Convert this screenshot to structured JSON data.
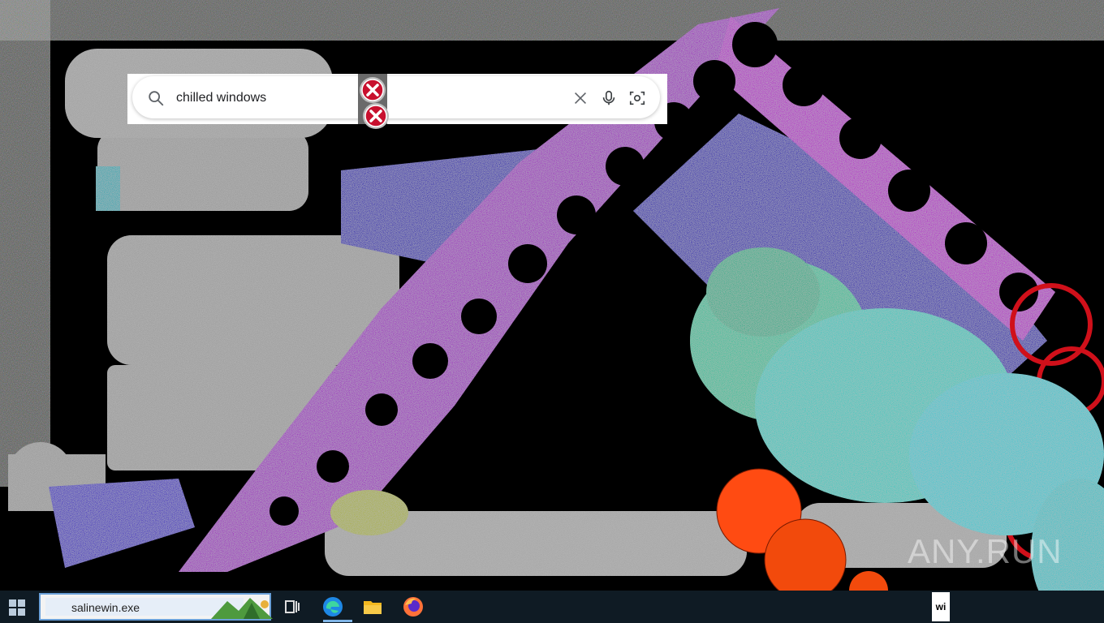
{
  "search": {
    "query": "chilled windows"
  },
  "icons": {
    "search": "search-icon",
    "clear": "close-icon",
    "voice": "microphone-icon",
    "lens": "camera-lens-icon",
    "error": "error-x-icon"
  },
  "taskbar": {
    "search_value": "salinewin.exe",
    "tray_text": "wi",
    "apps": [
      "task-view",
      "edge",
      "file-explorer",
      "firefox"
    ]
  },
  "watermark": "ANY.RUN",
  "colors": {
    "taskbar_bg": "#0f1b24",
    "error_red": "#c8102e",
    "purple_chain": "#a020c0",
    "blue_glitch": "#2a1fb0",
    "teal_glitch": "#3fd1b0",
    "orange_ball": "#ff4a10"
  }
}
